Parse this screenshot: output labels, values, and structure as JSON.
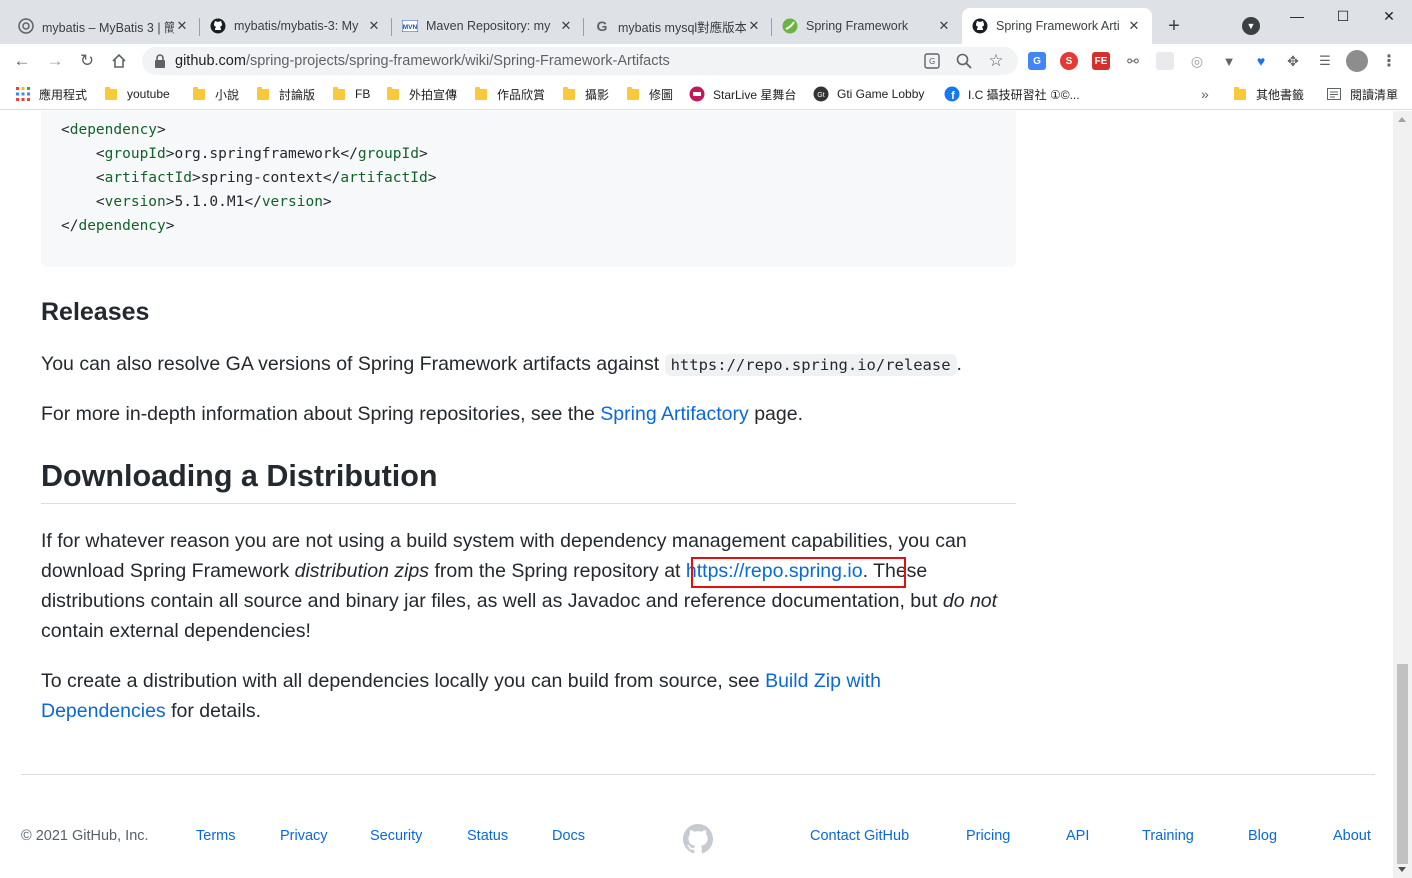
{
  "browser": {
    "tabs": [
      {
        "title": "mybatis – MyBatis 3 | 簡",
        "favicon": "chrome-icon"
      },
      {
        "title": "mybatis/mybatis-3: My",
        "favicon": "github-icon"
      },
      {
        "title": "Maven Repository: my",
        "favicon": "maven-icon"
      },
      {
        "title": "mybatis mysql對應版本",
        "favicon": "google-icon"
      },
      {
        "title": "Spring Framework",
        "favicon": "spring-icon"
      },
      {
        "title": "Spring Framework Arti",
        "favicon": "github-icon"
      }
    ],
    "url_host": "github.com",
    "url_path": "/spring-projects/spring-framework/wiki/Spring-Framework-Artifacts",
    "bookmarks": [
      {
        "label": "應用程式"
      },
      {
        "label": "youtube"
      },
      {
        "label": "小說"
      },
      {
        "label": "討論版"
      },
      {
        "label": "FB"
      },
      {
        "label": "外拍宣傳"
      },
      {
        "label": "作品欣賞"
      },
      {
        "label": "攝影"
      },
      {
        "label": "修圖"
      },
      {
        "label": "StarLive 星舞台"
      },
      {
        "label": "Gti Game Lobby"
      },
      {
        "label": "I.C 攝技研習社 ①©..."
      },
      {
        "label": "»"
      },
      {
        "label": "其他書籤"
      },
      {
        "label": "閱讀清單"
      }
    ]
  },
  "content": {
    "code_lines": [
      {
        "open": "<dependency>"
      },
      {
        "tag": "groupId",
        "value": "org.springframework"
      },
      {
        "tag": "artifactId",
        "value": "spring-context"
      },
      {
        "tag": "version",
        "value": "5.1.0.M1"
      },
      {
        "close": "</dependency>"
      }
    ],
    "releases_heading": "Releases",
    "releases_p1_text": "You can also resolve GA versions of Spring Framework artifacts against ",
    "releases_p1_code": "https://repo.spring.io/release",
    "releases_p1_end": ".",
    "releases_p2_text": "For more in-depth information about Spring repositories, see the ",
    "releases_p2_link": "Spring Artifactory",
    "releases_p2_end": " page.",
    "download_heading": "Downloading a Distribution",
    "download_p1_line1": "If for whatever reason you are not using a build system with dependency management capabilities, you can",
    "download_p1_line2_a": "download Spring Framework ",
    "download_p1_line2_em": "distribution zips",
    "download_p1_line2_b": " from the Spring repository at ",
    "download_p1_link": "https://repo.spring.io",
    "download_p1_line2_c": ". These",
    "download_p1_line3_a": "distributions contain all source and binary jar files, as well as Javadoc and reference documentation, but ",
    "download_p1_line3_em": "do not",
    "download_p1_line4": "contain external dependencies!",
    "download_p2_line1": "To create a distribution with all dependencies locally you can build from source, see ",
    "download_p2_link1": "Build Zip with",
    "download_p2_link2": "Dependencies",
    "download_p2_end": " for details."
  },
  "footer": {
    "copyright": "© 2021 GitHub, Inc.",
    "left_links": [
      "Terms",
      "Privacy",
      "Security",
      "Status",
      "Docs"
    ],
    "right_links": [
      "Contact GitHub",
      "Pricing",
      "API",
      "Training",
      "Blog",
      "About"
    ]
  },
  "colors": {
    "link": "#0969da",
    "highlight_box": "#e01010",
    "tag": "#116329"
  }
}
